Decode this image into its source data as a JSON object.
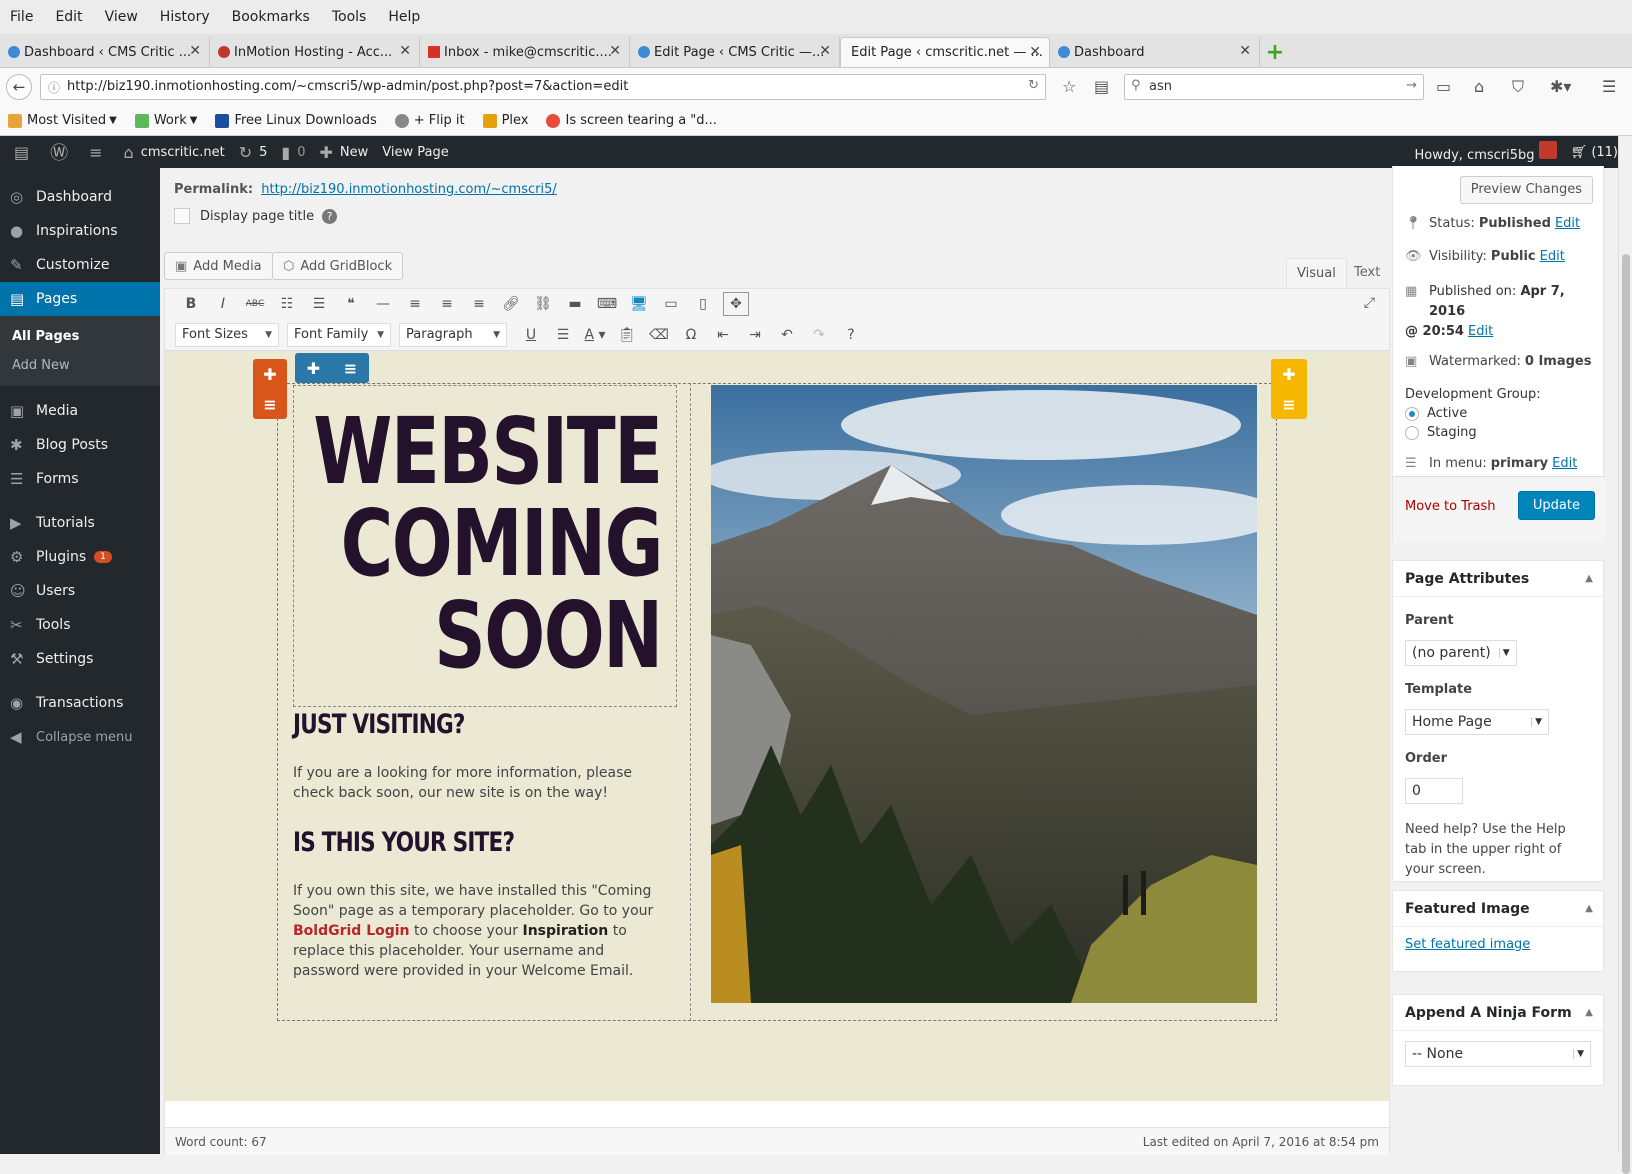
{
  "browser": {
    "menu": [
      "File",
      "Edit",
      "View",
      "History",
      "Bookmarks",
      "Tools",
      "Help"
    ],
    "tabs": [
      {
        "label": "Dashboard ‹ CMS Critic ...",
        "fav": "#3d8bd6"
      },
      {
        "label": "InMotion Hosting - Acc...",
        "fav": "#c0392b"
      },
      {
        "label": "Inbox - mike@cmscritic....",
        "fav": "#d93025"
      },
      {
        "label": "Edit Page ‹ CMS Critic —...",
        "fav": "#3d8bd6"
      },
      {
        "label": "Edit Page ‹ cmscritic.net — ...",
        "fav": "#888"
      },
      {
        "label": "Dashboard",
        "fav": "#3d8bd6"
      }
    ],
    "new_tab": "+",
    "url": "http://biz190.inmotionhosting.com/~cmscri5/wp-admin/post.php?post=7&action=edit",
    "search": "asn",
    "bookmarks": [
      {
        "label": "Most Visited",
        "color": "#e8a33a",
        "dropdown": true
      },
      {
        "label": "Work",
        "color": "#5cb85c",
        "dropdown": true
      },
      {
        "label": "Free Linux Downloads",
        "color": "#1a4fa0",
        "dropdown": false
      },
      {
        "label": "+ Flip it",
        "color": "#888",
        "dropdown": false
      },
      {
        "label": "Plex",
        "color": "#e5a00d",
        "dropdown": false
      },
      {
        "label": "Is screen tearing a \"d...",
        "color": "#e74c3c",
        "dropdown": false
      }
    ]
  },
  "adminbar": {
    "site": "cmscritic.net",
    "updates": "5",
    "comments": "0",
    "new": "New",
    "view_page": "View Page",
    "howdy": "Howdy, cmscri5bg",
    "cart": "(11)"
  },
  "sidebar": {
    "items": [
      {
        "label": "Dashboard",
        "icon": "◎"
      },
      {
        "label": "Inspirations",
        "icon": "●"
      },
      {
        "label": "Customize",
        "icon": "✎"
      },
      {
        "label": "Pages",
        "icon": "▤",
        "active": true
      },
      {
        "label": "Media",
        "icon": "▣"
      },
      {
        "label": "Blog Posts",
        "icon": "✱"
      },
      {
        "label": "Forms",
        "icon": "☰"
      },
      {
        "label": "Tutorials",
        "icon": "▶"
      },
      {
        "label": "Plugins",
        "icon": "⚙",
        "badge": "1"
      },
      {
        "label": "Users",
        "icon": "☺"
      },
      {
        "label": "Tools",
        "icon": "✂"
      },
      {
        "label": "Settings",
        "icon": "⚒"
      },
      {
        "label": "Transactions",
        "icon": "◉"
      }
    ],
    "sub": [
      "All Pages",
      "Add New"
    ],
    "collapse": "Collapse menu"
  },
  "editor": {
    "permalink_label": "Permalink:",
    "permalink_url": "http://biz190.inmotionhosting.com/~cmscri5/",
    "display_title": "Display page title",
    "add_media": "Add Media",
    "add_gridblock": "Add GridBlock",
    "tab_visual": "Visual",
    "tab_text": "Text",
    "font_sizes": "Font Sizes",
    "font_family": "Font Family",
    "paragraph": "Paragraph",
    "title_lines": [
      "WEBSITE",
      "COMING",
      "SOON"
    ],
    "h_visiting": "JUST VISITING?",
    "p_visiting": "If you are a looking for more information, please check back soon, our new site is on the way!",
    "h_yoursite": "IS THIS YOUR SITE?",
    "p_yoursite_1": "If you own this site, we have installed this \"Coming Soon\" page as a temporary placeholder. Go to your",
    "p_yoursite_link": "BoldGrid Login",
    "p_yoursite_2": "to choose your",
    "p_yoursite_bold": "Inspiration",
    "p_yoursite_3": "to replace this placeholder. Your username and password were provided in your Welcome Email.",
    "word_count": "Word count: 67",
    "last_edited": "Last edited on April 7, 2016 at 8:54 pm"
  },
  "publish": {
    "preview": "Preview Changes",
    "status_label": "Status:",
    "status": "Published",
    "visibility_label": "Visibility:",
    "visibility": "Public",
    "published_label": "Published on:",
    "published_on": "Apr 7, 2016",
    "published_time": "@ 20:54",
    "watermarked_label": "Watermarked:",
    "watermarked": "0 Images",
    "dev_group": "Development Group:",
    "active": "Active",
    "staging": "Staging",
    "menu_label": "In menu:",
    "menu": "primary",
    "edit": "Edit",
    "trash": "Move to Trash",
    "update": "Update"
  },
  "attributes": {
    "title": "Page Attributes",
    "parent_label": "Parent",
    "parent": "(no parent)",
    "template_label": "Template",
    "template": "Home Page",
    "order_label": "Order",
    "order": "0",
    "help": "Need help? Use the Help tab in the upper right of your screen."
  },
  "featured": {
    "title": "Featured Image",
    "link": "Set featured image"
  },
  "ninja": {
    "title": "Append A Ninja Form",
    "value": "-- None"
  }
}
